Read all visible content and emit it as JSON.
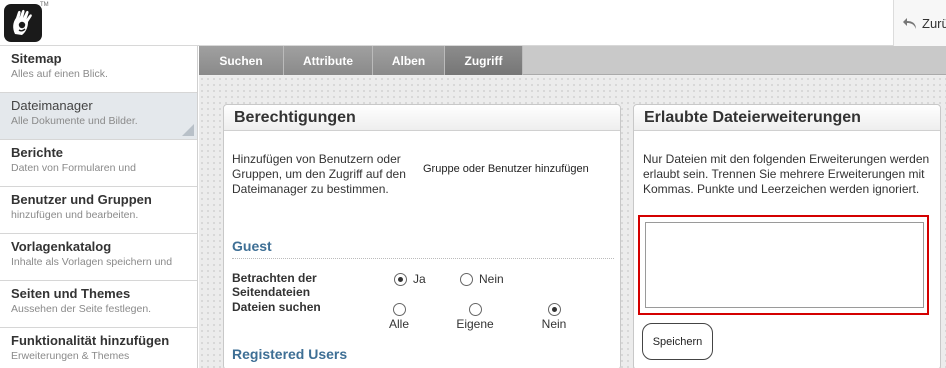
{
  "header": {
    "logo_icon": "concrete5-hand-icon",
    "trademark": "TM",
    "back_label": "Zurü"
  },
  "sidebar": {
    "items": [
      {
        "title": "Sitemap",
        "subtitle": "Alles auf einen Blick.",
        "active": false
      },
      {
        "title": "Dateimanager",
        "subtitle": "Alle Dokumente und Bilder.",
        "active": true
      },
      {
        "title": "Berichte",
        "subtitle": "Daten von Formularen und",
        "active": false
      },
      {
        "title": "Benutzer und Gruppen",
        "subtitle": "hinzufügen und bearbeiten.",
        "active": false
      },
      {
        "title": "Vorlagenkatalog",
        "subtitle": "Inhalte als Vorlagen speichern und",
        "active": false
      },
      {
        "title": "Seiten und Themes",
        "subtitle": "Aussehen der Seite festlegen.",
        "active": false
      },
      {
        "title": "Funktionalität hinzufügen",
        "subtitle": "Erweiterungen & Themes",
        "active": false
      }
    ]
  },
  "tabs": [
    {
      "label": "Suchen",
      "active": false
    },
    {
      "label": "Attribute",
      "active": false
    },
    {
      "label": "Alben",
      "active": false
    },
    {
      "label": "Zugriff",
      "active": true
    }
  ],
  "permissions": {
    "title": "Berechtigungen",
    "intro": "Hinzufügen von Benutzern oder Gruppen, um den Zugriff auf den Dateimanager zu bestimmen.",
    "add_link": "Gruppe oder Benutzer hinzufügen",
    "groups": [
      {
        "name": "Guest",
        "view_label": "Betrachten der Seitendateien",
        "view_yes": "Ja",
        "view_no": "Nein",
        "view_selected": "Ja",
        "search_label": "Dateien suchen",
        "search_options": [
          "Alle",
          "Eigene",
          "Nein"
        ],
        "search_selected": "Nein"
      },
      {
        "name": "Registered Users"
      }
    ]
  },
  "extensions": {
    "title": "Erlaubte Dateierweiterungen",
    "description": "Nur Dateien mit den folgenden Erweiterungen werden erlaubt sein. Trennen Sie mehrere Erweiterungen mit Kommas. Punkte und Leerzeichen werden ignoriert.",
    "value": "",
    "save_label": "Speichern"
  },
  "colors": {
    "highlight_border": "#d40000",
    "group_title": "#3e6f95",
    "tab_active": "#7e7e7e"
  }
}
